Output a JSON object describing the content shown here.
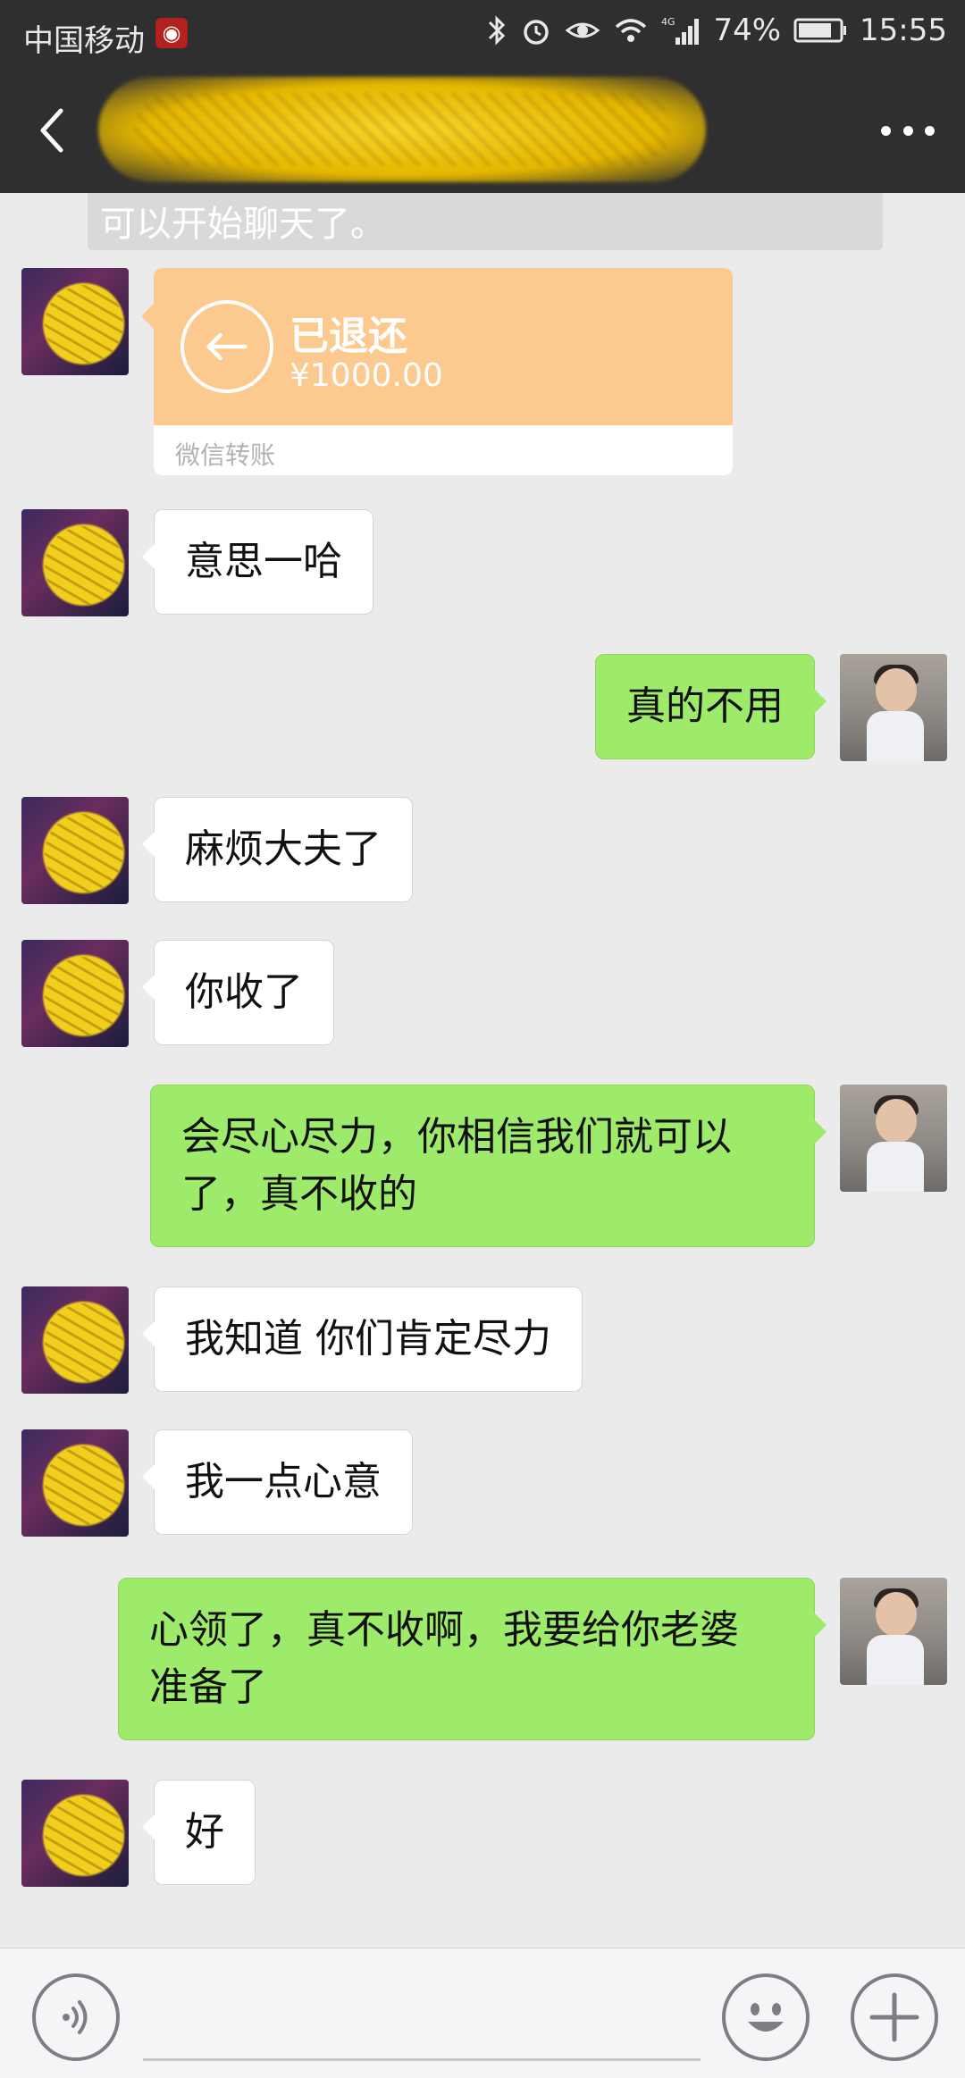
{
  "status_bar": {
    "carrier": "中国移动",
    "network": "4G",
    "battery_percent": "74%",
    "time": "15:55",
    "icons": [
      "weibo-icon",
      "bluetooth-icon",
      "alarm-icon",
      "eye-icon",
      "wifi-icon",
      "signal-icon",
      "battery-icon"
    ]
  },
  "header": {
    "back_icon": "chevron-left-icon",
    "more_icon": "more-dots-icon"
  },
  "system_message": "可以开始聊天了。",
  "transfer": {
    "status": "已退还",
    "amount": "¥1000.00",
    "footer": "微信转账",
    "icon": "return-arrow-icon",
    "color": "#fcc98f"
  },
  "messages": [
    {
      "from": "other",
      "text": "意思一哈"
    },
    {
      "from": "self",
      "text": "真的不用"
    },
    {
      "from": "other",
      "text": "麻烦大夫了"
    },
    {
      "from": "other",
      "text": "你收了"
    },
    {
      "from": "self",
      "text_line1": "会尽心尽力，你相信我们就可以",
      "text_line2": "了，真不收的"
    },
    {
      "from": "other",
      "text": "我知道 你们肯定尽力"
    },
    {
      "from": "other",
      "text": "我一点心意"
    },
    {
      "from": "self",
      "text_line1": "心领了，真不收啊，我要给你老婆",
      "text_line2": "准备了"
    },
    {
      "from": "other",
      "text": "好"
    }
  ],
  "colors": {
    "title_bar": "#2f2f2f",
    "chat_background": "#ebebeb",
    "outgoing_bubble": "#9eea6a",
    "incoming_bubble": "#ffffff"
  },
  "input_bar": {
    "voice_icon": "voice-icon",
    "emoji_icon": "emoji-icon",
    "plus_icon": "plus-icon",
    "placeholder": ""
  }
}
